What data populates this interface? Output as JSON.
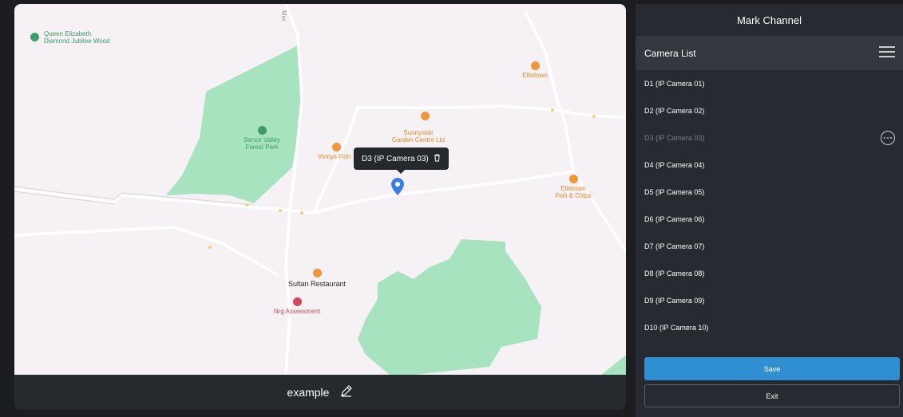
{
  "map": {
    "pois": {
      "queen_elizabeth": "Queen Elizabeth\nDiamond Jubilee Wood",
      "ellistown": "Ellistown",
      "sunnyside": "Sunnyside\nGarden Centre Ltd",
      "sence_valley": "Sence Valley\nForest Park",
      "vinnys": "Vinnys Fish",
      "ellistown_fish": "Ellistown\nFish & Chips",
      "sultan": "Sultan Restaurant",
      "nrg": "Nrg Assessment",
      "road_mer": "Mer"
    },
    "tooltip": {
      "label": "D3 (IP Camera 03)",
      "delete_icon": "trash-icon"
    },
    "pin_icon": "map-pin-icon",
    "footer": {
      "name": "example",
      "edit_icon": "pencil-icon"
    },
    "colors": {
      "land": "#f6f1f4",
      "park": "#a8e3c0",
      "poi_orange": "#e38a2c",
      "pin": "#3b7fe0"
    }
  },
  "panel": {
    "title": "Mark Channel",
    "list_title": "Camera List",
    "menu_icon": "hamburger-menu-icon",
    "cameras": [
      {
        "label": "D1 (IP Camera 01)"
      },
      {
        "label": "D2 (IP Camera 02)"
      },
      {
        "label": "D3 (IP Camera 03)",
        "state": "disabled",
        "action_icon": "more-options-icon"
      },
      {
        "label": "D4 (IP Camera 04)"
      },
      {
        "label": "D5 (IP Camera 05)"
      },
      {
        "label": "D6 (IP Camera 06)"
      },
      {
        "label": "D7 (IP Camera 07)"
      },
      {
        "label": "D8 (IP Camera 08)"
      },
      {
        "label": "D9 (IP Camera 09)"
      },
      {
        "label": "D10 (IP Camera 10)"
      }
    ],
    "save_label": "Save",
    "exit_label": "Exit",
    "colors": {
      "save": "#2f8fd1"
    }
  }
}
